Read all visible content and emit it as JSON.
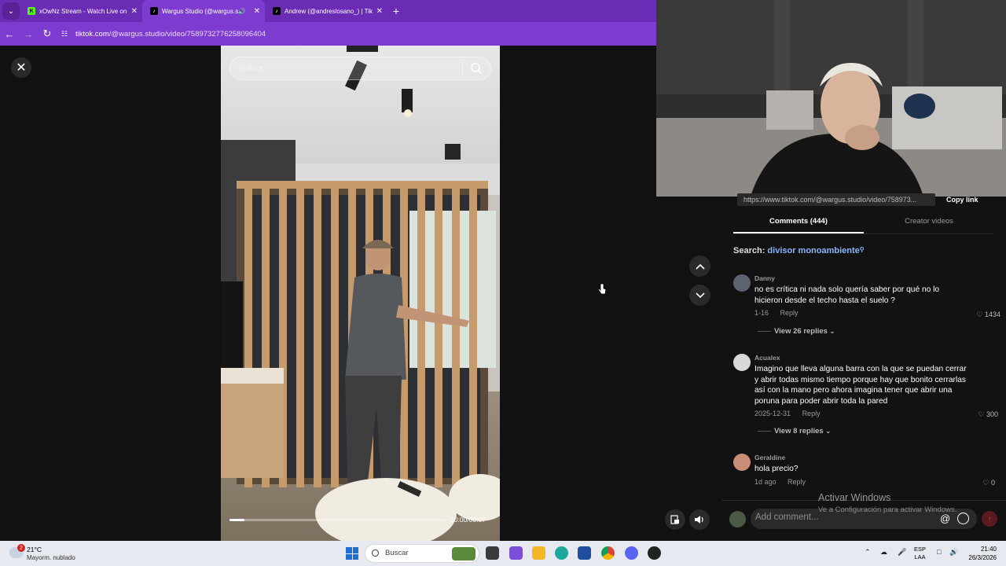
{
  "browser": {
    "tabs": [
      {
        "title": "xOwNz Stream - Watch Live on",
        "favicon": "kick-icon"
      },
      {
        "title": "Wargus Studio (@wargus.st",
        "favicon": "tiktok-icon",
        "audio": true
      },
      {
        "title": "Andrew (@andreslosano_) | Tik",
        "favicon": "tiktok-icon"
      }
    ],
    "url_host": "tiktok.com",
    "url_path": "/@wargus.studio/video/7589732776258096404"
  },
  "video": {
    "search_placeholder": "divisor",
    "time": "00:00/00:07",
    "progress": 0.07
  },
  "share": {
    "url": "https://www.tiktok.com/@wargus.studio/video/758973...",
    "copy_label": "Copy link"
  },
  "comments_panel": {
    "tab_comments": "Comments (444)",
    "tab_creator": "Creator videos",
    "search_label": "Search:",
    "search_term": "divisor monoambiente",
    "comments": [
      {
        "name": "Danny",
        "text": "no es crítica ni nada solo quería saber por qué no lo hicieron desde el techo hasta el suelo ?",
        "date": "1-16",
        "reply": "Reply",
        "likes": "1434",
        "replies": "View 26 replies"
      },
      {
        "name": "Acualex",
        "text": "Imagino que lleva alguna barra con la que se puedan cerrar y abrir todas mismo tiempo porque hay que bonito cerrarlas así con la mano pero ahora imagina tener que abrir una poruna para poder abrir toda la pared",
        "date": "2025-12-31",
        "reply": "Reply",
        "likes": "300",
        "replies": "View 8 replies"
      },
      {
        "name": "Geraldine",
        "text": "hola precio?",
        "date": "1d ago",
        "reply": "Reply",
        "likes": "0"
      }
    ],
    "add_comment_placeholder": "Add comment..."
  },
  "watermark": {
    "title": "Activar Windows",
    "subtitle": "Ve a Configuración para activar Windows."
  },
  "taskbar": {
    "weather_temp": "21°C",
    "weather_cond": "Mayorm. nublado",
    "weather_badge": "2",
    "search_label": "Buscar",
    "lang_top": "ESP",
    "lang_bottom": "LAA",
    "time": "21:40",
    "date": "26/3/2026"
  }
}
